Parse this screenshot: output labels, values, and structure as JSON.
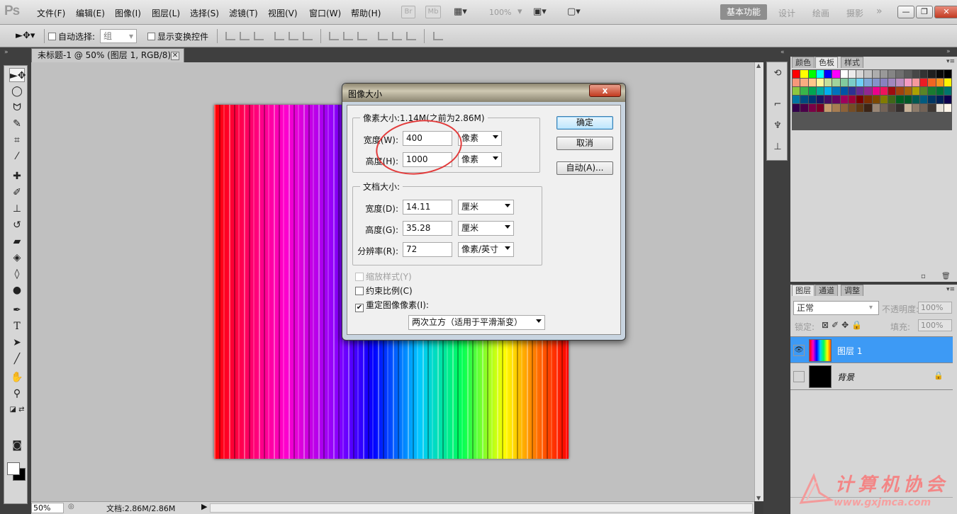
{
  "app": {
    "logo": "Ps"
  },
  "menus": [
    "文件(F)",
    "编辑(E)",
    "图像(I)",
    "图层(L)",
    "选择(S)",
    "滤镜(T)",
    "视图(V)",
    "窗口(W)",
    "帮助(H)"
  ],
  "menubar": {
    "br_label": "Br",
    "mb_label": "Mb",
    "zoom": "100%"
  },
  "workspaces": {
    "active": "基本功能",
    "others": [
      "设计",
      "绘画",
      "摄影"
    ],
    "more": "»"
  },
  "window_controls": {
    "minimize": "—",
    "restore": "❐",
    "close": "✕"
  },
  "options_bar": {
    "auto_select_label": "自动选择:",
    "auto_select_value": "组",
    "show_transform_label": "显示变换控件"
  },
  "document": {
    "tab_title": "未标题-1 @ 50% (图层 1, RGB/8) *",
    "close": "✕"
  },
  "status_bar": {
    "zoom": "50%",
    "doc_info": "文档:2.86M/2.86M"
  },
  "swatches_panel": {
    "tabs": [
      "颜色",
      "色板",
      "样式"
    ],
    "active_tab": "色板",
    "colors": [
      "#ff0000",
      "#ffff00",
      "#00ff00",
      "#00ffff",
      "#0000ff",
      "#ff00ff",
      "#ffffff",
      "#ebebeb",
      "#d6d6d6",
      "#c2c2c2",
      "#adadad",
      "#999999",
      "#858585",
      "#707070",
      "#5c5c5c",
      "#474747",
      "#333333",
      "#1f1f1f",
      "#0a0a0a",
      "#000000",
      "#f7977a",
      "#f9ad81",
      "#fdc68a",
      "#fff79a",
      "#c4df9b",
      "#a2d39c",
      "#82ca9d",
      "#7bcdc8",
      "#6ecff6",
      "#7ea7d8",
      "#8493ca",
      "#8882be",
      "#a187be",
      "#bc8dbf",
      "#f49ac2",
      "#f6989d",
      "#ed1c24",
      "#f26522",
      "#f7941d",
      "#fff200",
      "#8dc73f",
      "#39b54a",
      "#00a651",
      "#00a99d",
      "#00aeef",
      "#0072bc",
      "#0054a6",
      "#2e3192",
      "#662d91",
      "#92278f",
      "#ec008c",
      "#ed145b",
      "#9e0b0f",
      "#a0410d",
      "#a36209",
      "#aba000",
      "#598527",
      "#1a7b30",
      "#007236",
      "#00746b",
      "#0076a3",
      "#004b80",
      "#003471",
      "#1b1464",
      "#440e62",
      "#630460",
      "#9e005d",
      "#9e0039",
      "#790000",
      "#7b2e00",
      "#7d4900",
      "#827b00",
      "#406618",
      "#005e20",
      "#005826",
      "#005952",
      "#005b7f",
      "#003663",
      "#002157",
      "#0d004c",
      "#32004b",
      "#4b0049",
      "#7b0046",
      "#7a0026",
      "#c69c6e",
      "#a67c52",
      "#8c6239",
      "#754c24",
      "#603913",
      "#3c2415",
      "#998675",
      "#736357",
      "#534741",
      "#362f2d",
      "#c7b299",
      "#8c7b6b",
      "#726357",
      "#3f3935",
      "#e6e0d6",
      "#fcf4e9"
    ]
  },
  "layers_panel": {
    "tabs": [
      "图层",
      "通道",
      "调整"
    ],
    "active_tab": "图层",
    "blend_mode": "正常",
    "opacity_label": "不透明度:",
    "opacity": "100%",
    "lock_label": "锁定:",
    "fill_label": "填充:",
    "fill": "100%",
    "layers": [
      {
        "name": "图层 1",
        "visible": true,
        "selected": true
      },
      {
        "name": "背景",
        "visible": false,
        "selected": false
      }
    ]
  },
  "dialog": {
    "title": "图像大小",
    "close": "x",
    "pixel_dims": {
      "title": "像素大小:1.14M(之前为2.86M)",
      "width_label": "宽度(W):",
      "width": "400",
      "width_unit": "像素",
      "height_label": "高度(H):",
      "height": "1000",
      "height_unit": "像素"
    },
    "doc_size": {
      "title": "文档大小:",
      "width_label": "宽度(D):",
      "width": "14.11",
      "width_unit": "厘米",
      "height_label": "高度(G):",
      "height": "35.28",
      "height_unit": "厘米",
      "res_label": "分辨率(R):",
      "res": "72",
      "res_unit": "像素/英寸"
    },
    "scale_styles": {
      "label": "缩放样式(Y)",
      "checked": false,
      "disabled": true
    },
    "constrain": {
      "label": "约束比例(C)",
      "checked": false
    },
    "resample": {
      "label": "重定图像像素(I):",
      "checked": true
    },
    "resample_method": "两次立方（适用于平滑渐变）",
    "buttons": {
      "ok": "确定",
      "cancel": "取消",
      "auto": "自动(A)..."
    }
  },
  "watermark": {
    "text": "计算机协会",
    "url": "www.gxjmca.com"
  }
}
